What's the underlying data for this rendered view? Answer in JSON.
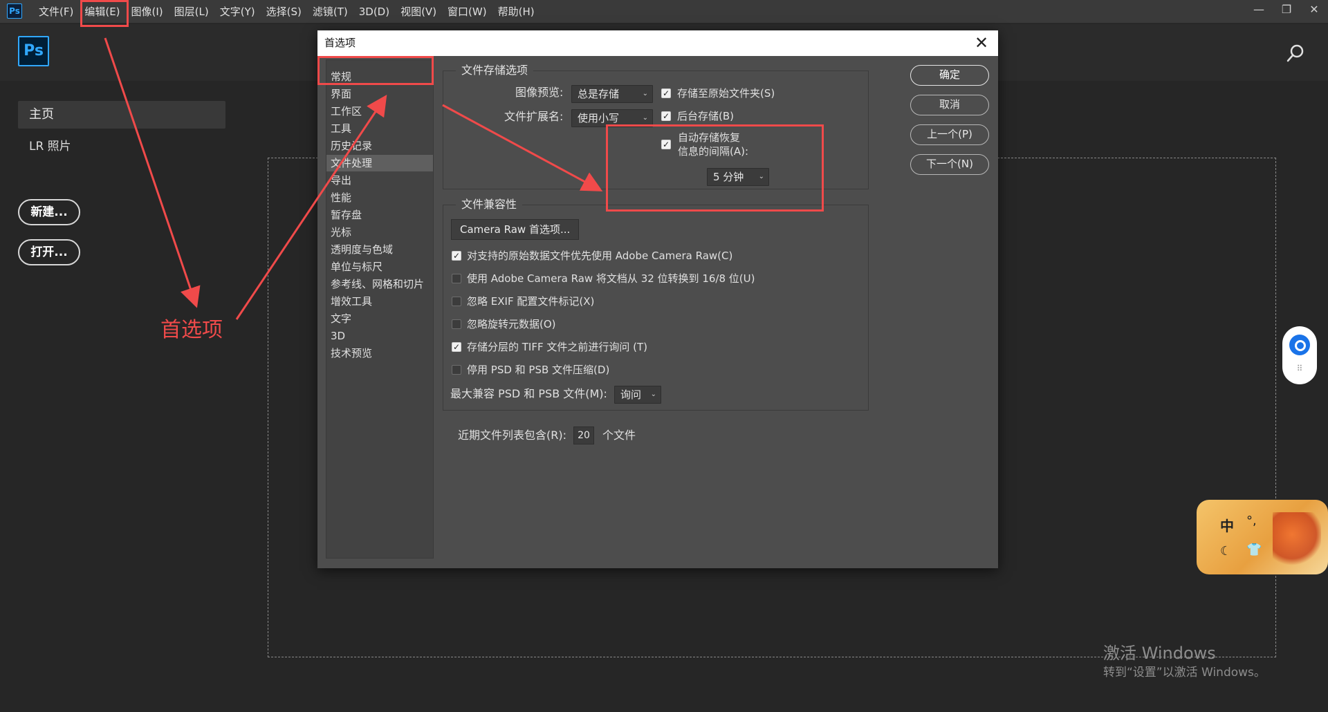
{
  "menubar": {
    "logo": "Ps",
    "items": [
      "文件(F)",
      "编辑(E)",
      "图像(I)",
      "图层(L)",
      "文字(Y)",
      "选择(S)",
      "滤镜(T)",
      "3D(D)",
      "视图(V)",
      "窗口(W)",
      "帮助(H)"
    ],
    "window_controls": [
      "—",
      "❐",
      "✕"
    ]
  },
  "home": {
    "logo": "Ps",
    "sidebar": [
      "主页",
      "LR 照片"
    ],
    "new_button": "新建...",
    "open_button": "打开..."
  },
  "dialog": {
    "title": "首选项",
    "close": "✕",
    "categories": [
      "常规",
      "界面",
      "工作区",
      "工具",
      "历史记录",
      "文件处理",
      "导出",
      "性能",
      "暂存盘",
      "光标",
      "透明度与色域",
      "单位与标尺",
      "参考线、网格和切片",
      "增效工具",
      "文字",
      "3D",
      "技术预览"
    ],
    "selected_category": "文件处理",
    "file_save": {
      "title": "文件存储选项",
      "image_preview_label": "图像预览:",
      "image_preview_value": "总是存储",
      "extension_label": "文件扩展名:",
      "extension_value": "使用小写",
      "save_to_original": "存储至原始文件夹(S)",
      "save_to_original_checked": true,
      "background_save": "后台存储(B)",
      "background_save_checked": true,
      "auto_save_line1": "自动存储恢复",
      "auto_save_line2": "信息的间隔(A):",
      "auto_save_checked": true,
      "auto_save_interval": "5 分钟"
    },
    "compat": {
      "title": "文件兼容性",
      "camera_raw_button": "Camera Raw 首选项...",
      "options": [
        {
          "label": "对支持的原始数据文件优先使用 Adobe Camera Raw(C)",
          "checked": true
        },
        {
          "label": "使用 Adobe Camera Raw 将文档从 32 位转换到 16/8 位(U)",
          "checked": false
        },
        {
          "label": "忽略 EXIF 配置文件标记(X)",
          "checked": false
        },
        {
          "label": "忽略旋转元数据(O)",
          "checked": false
        },
        {
          "label": "存储分层的 TIFF 文件之前进行询问 (T)",
          "checked": true
        },
        {
          "label": "停用 PSD 和 PSB 文件压缩(D)",
          "checked": false
        }
      ],
      "max_compat_label": "最大兼容 PSD 和 PSB 文件(M):",
      "max_compat_value": "询问"
    },
    "recent": {
      "label": "近期文件列表包含(R):",
      "value": "20",
      "unit": "个文件"
    },
    "buttons": {
      "ok": "确定",
      "cancel": "取消",
      "prev": "上一个(P)",
      "next": "下一个(N)"
    }
  },
  "annotation": {
    "label": "首选项",
    "color": "#f04a4a"
  },
  "ime": {
    "char": "中",
    "sym": "°,",
    "moon": "☾",
    "shirt": "👕"
  },
  "watermark": {
    "title": "激活 Windows",
    "subtitle": "转到“设置”以激活 Windows。"
  },
  "colors": {
    "background": "#262626",
    "menubar": "#3a3a3a",
    "dialog": "#4d4d4d",
    "ps_blue": "#31a8ff",
    "annotation_red": "#f04a4a"
  }
}
